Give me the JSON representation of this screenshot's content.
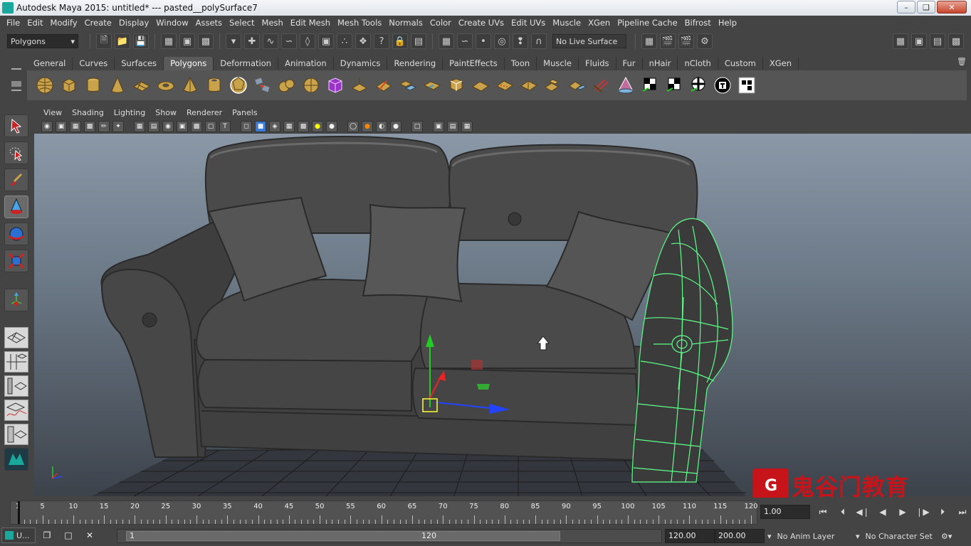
{
  "window": {
    "title": "Autodesk Maya 2015: untitled*   ---   pasted__polySurface7"
  },
  "menus": [
    "File",
    "Edit",
    "Modify",
    "Create",
    "Display",
    "Window",
    "Assets",
    "Select",
    "Mesh",
    "Edit Mesh",
    "Mesh Tools",
    "Normals",
    "Color",
    "Create UVs",
    "Edit UVs",
    "Muscle",
    "XGen",
    "Pipeline Cache",
    "Bifrost",
    "Help"
  ],
  "status_line": {
    "mode": "Polygons",
    "live_surface": "No Live Surface"
  },
  "shelf": {
    "tabs": [
      "General",
      "Curves",
      "Surfaces",
      "Polygons",
      "Deformation",
      "Animation",
      "Dynamics",
      "Rendering",
      "PaintEffects",
      "Toon",
      "Muscle",
      "Fluids",
      "Fur",
      "nHair",
      "nCloth",
      "Custom",
      "XGen"
    ],
    "active_tab": "Polygons"
  },
  "panel_menus": [
    "View",
    "Shading",
    "Lighting",
    "Show",
    "Renderer",
    "Panels"
  ],
  "timeslider": {
    "ticks": [
      "1",
      "5",
      "10",
      "15",
      "20",
      "25",
      "30",
      "35",
      "40",
      "45",
      "50",
      "55",
      "60",
      "65",
      "70",
      "75",
      "80",
      "85",
      "90",
      "95",
      "100",
      "105",
      "110",
      "115",
      "120"
    ],
    "current_time": "1.00"
  },
  "range": {
    "taskbar_label": "U...",
    "start_label": "1",
    "end_label": "120",
    "anim_end": "120.00",
    "max_end": "200.00",
    "anim_layer": "No Anim Layer",
    "character_set": "No Character Set"
  },
  "watermark": {
    "logo": "G",
    "text": "鬼谷门教育"
  },
  "colors": {
    "accent": "#1aa79c",
    "wireframe": "#5cff8a",
    "viewport_top": "#8a98a7",
    "viewport_bottom": "#3d434b"
  }
}
